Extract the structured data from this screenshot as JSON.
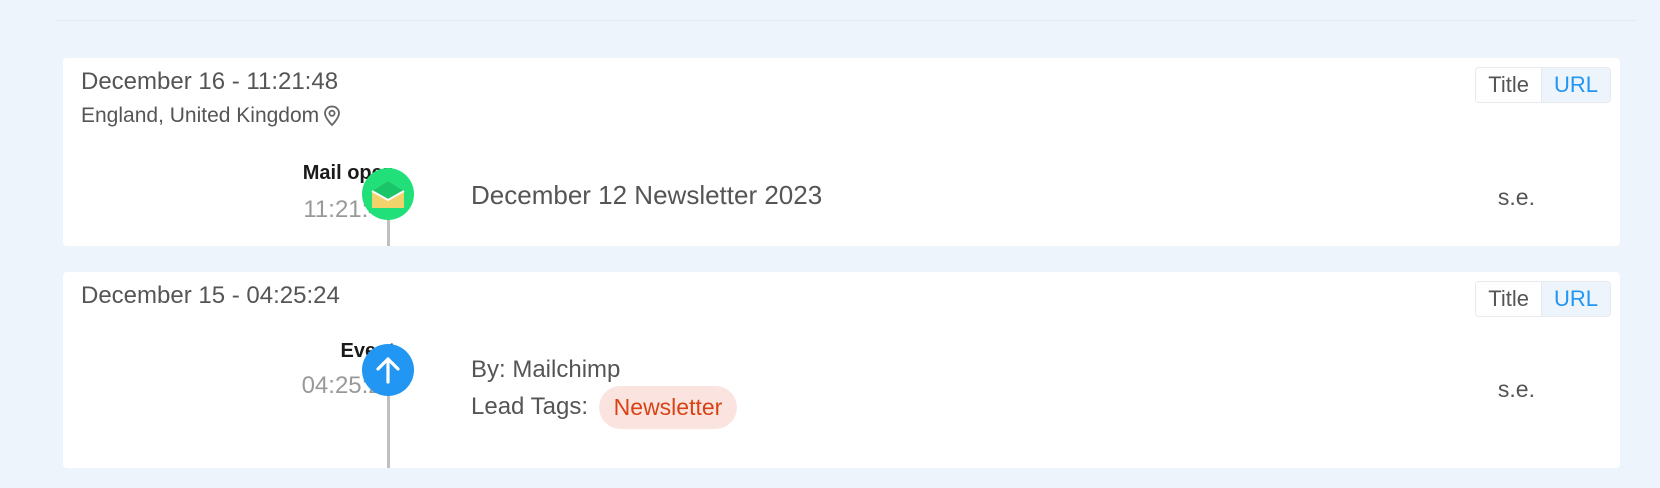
{
  "toggle": {
    "title_label": "Title",
    "url_label": "URL"
  },
  "entries": [
    {
      "date": "December 16 - 11:21:48",
      "location": "England, United Kingdom",
      "event_type": "Mail open",
      "event_time": "11:21:48",
      "title": "December 12 Newsletter 2023",
      "right_text": "s.e.",
      "icon": "mail-open-icon"
    },
    {
      "date": "December 15 - 04:25:24",
      "event_type": "Event",
      "event_time": "04:25:24",
      "by_text": "By: Mailchimp",
      "lead_tags_label": "Lead Tags:",
      "tag": "Newsletter",
      "right_text": "s.e.",
      "icon": "arrow-up-icon"
    }
  ],
  "colors": {
    "accent": "#2196f3",
    "mail_circle": "#21e07a",
    "event_circle": "#2196f3",
    "tag_bg": "#fbe4df",
    "tag_text": "#d84315"
  }
}
